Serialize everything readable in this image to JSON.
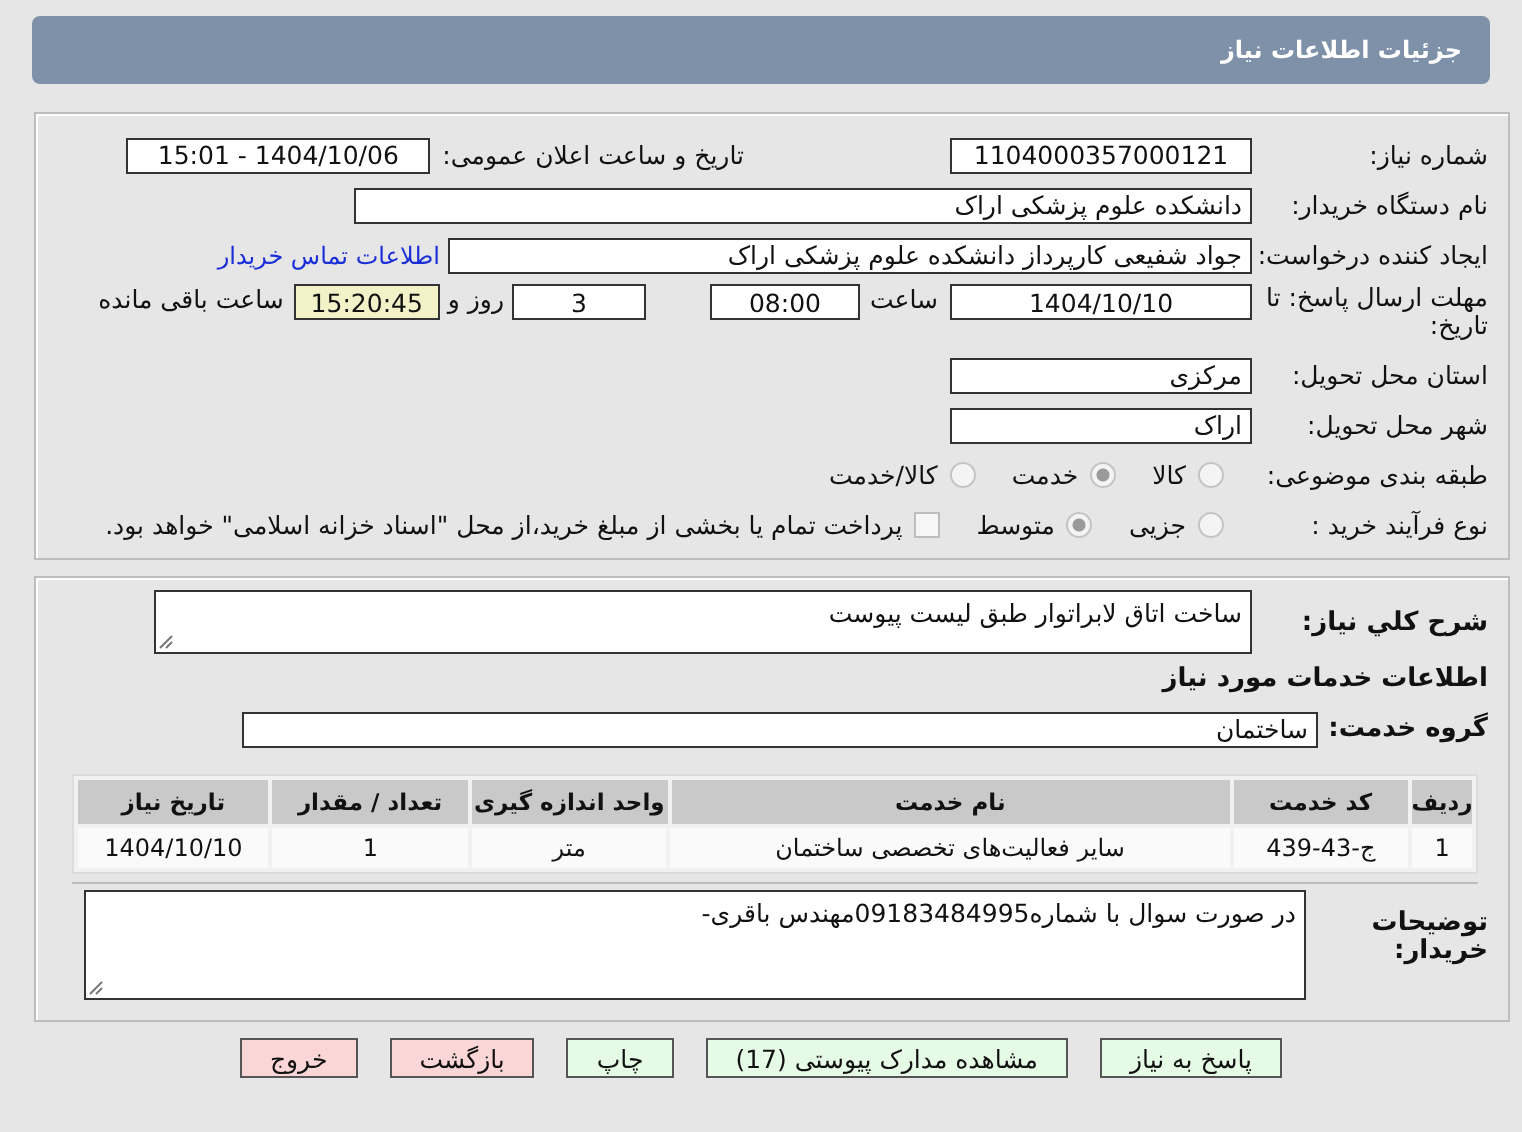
{
  "header": {
    "title": "جزئیات اطلاعات نیاز"
  },
  "need_number": {
    "label": "شماره نیاز:",
    "value": "1104000357000121"
  },
  "announce": {
    "label": "تاریخ و ساعت اعلان عمومی:",
    "value": "1404/10/06 - 15:01"
  },
  "buyer_org": {
    "label": "نام دستگاه خریدار:",
    "value": "دانشکده علوم پزشکی اراک"
  },
  "requester": {
    "label": "ایجاد کننده درخواست:",
    "value": "جواد شفیعی کارپرداز دانشکده علوم پزشکی اراک",
    "link": "اطلاعات تماس خریدار"
  },
  "deadline": {
    "label": "مهلت ارسال پاسخ: تا تاریخ:",
    "date": "1404/10/10",
    "time_label": "ساعت",
    "time": "08:00",
    "days": "3",
    "days_label": "روز و",
    "remaining": "15:20:45",
    "remaining_label": "ساعت باقی مانده"
  },
  "province": {
    "label": "استان محل تحویل:",
    "value": "مرکزی"
  },
  "city": {
    "label": "شهر محل تحویل:",
    "value": "اراک"
  },
  "category": {
    "label": "طبقه بندی موضوعی:",
    "options": [
      {
        "label": "کالا",
        "selected": false
      },
      {
        "label": "خدمت",
        "selected": true
      },
      {
        "label": "کالا/خدمت",
        "selected": false
      }
    ]
  },
  "purchase_type": {
    "label": "نوع فرآیند خرید :",
    "options": [
      {
        "label": "جزیی",
        "selected": false
      },
      {
        "label": "متوسط",
        "selected": true
      }
    ],
    "payment": {
      "label": "پرداخت تمام یا بخشی از مبلغ خرید،از محل \"اسناد خزانه اسلامی\" خواهد بود.",
      "checked": false
    }
  },
  "summary": {
    "label": "شرح کلي نياز:",
    "value": "ساخت اتاق لابراتوار طبق لیست پیوست"
  },
  "services_heading": "اطلاعات خدمات مورد نياز",
  "service_group": {
    "label": "گروه خدمت:",
    "value": "ساختمان"
  },
  "table": {
    "columns": [
      "ردیف",
      "کد خدمت",
      "نام خدمت",
      "واحد اندازه گیری",
      "تعداد / مقدار",
      "تاریخ نیاز"
    ],
    "rows": [
      [
        "1",
        "ج-43-439",
        "سایر فعالیت‌های تخصصی ساختمان",
        "متر",
        "1",
        "1404/10/10"
      ]
    ]
  },
  "buyer_notes": {
    "label": "توضیحات خریدار:",
    "value": "در صورت سوال با شماره09183484995مهندس باقری-"
  },
  "buttons": [
    {
      "label": "پاسخ به نیاز",
      "kind": "primary"
    },
    {
      "label": "مشاهده مدارک پیوستی (17)",
      "kind": "primary"
    },
    {
      "label": "چاپ",
      "kind": "primary"
    },
    {
      "label": "بازگشت",
      "kind": "danger"
    },
    {
      "label": "خروج",
      "kind": "danger"
    }
  ]
}
